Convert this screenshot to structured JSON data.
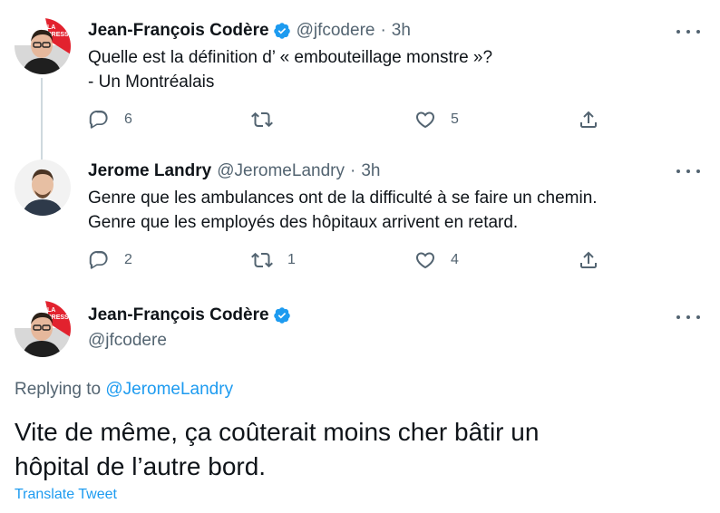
{
  "tweets": [
    {
      "name": "Jean-François Codère",
      "verified": true,
      "handle": "@jfcodere",
      "separator": "·",
      "time": "3h",
      "text_lines": [
        "Quelle est la définition d’ « embouteillage monstre »?",
        "- Un Montréalais"
      ],
      "replies": "6",
      "retweets": "",
      "likes": "5",
      "avatar_badge": "LA PRESSE"
    },
    {
      "name": "Jerome Landry",
      "verified": false,
      "handle": "@JeromeLandry",
      "separator": "·",
      "time": "3h",
      "text_lines": [
        "Genre que les ambulances ont de la difficulté à se faire un chemin.",
        "Genre que les employés des hôpitaux arrivent en retard."
      ],
      "replies": "2",
      "retweets": "1",
      "likes": "4"
    }
  ],
  "main_tweet": {
    "name": "Jean-François Codère",
    "verified": true,
    "handle": "@jfcodere",
    "replying_prefix": "Replying to",
    "replying_to": "@JeromeLandry",
    "text_lines": [
      "Vite de même, ça coûterait moins cher bâtir un",
      "hôpital de l’autre bord."
    ],
    "translate_label": "Translate Tweet",
    "avatar_badge": "LA PRESSE"
  },
  "icons": {
    "reply": "reply-icon",
    "retweet": "retweet-icon",
    "like": "heart-icon",
    "share": "share-icon",
    "more": "more-icon",
    "verified": "verified-badge-icon"
  },
  "colors": {
    "accent": "#1d9bf0",
    "secondary_text": "#536471",
    "thread_line": "#cfd9de",
    "badge_red": "#e2222e"
  }
}
